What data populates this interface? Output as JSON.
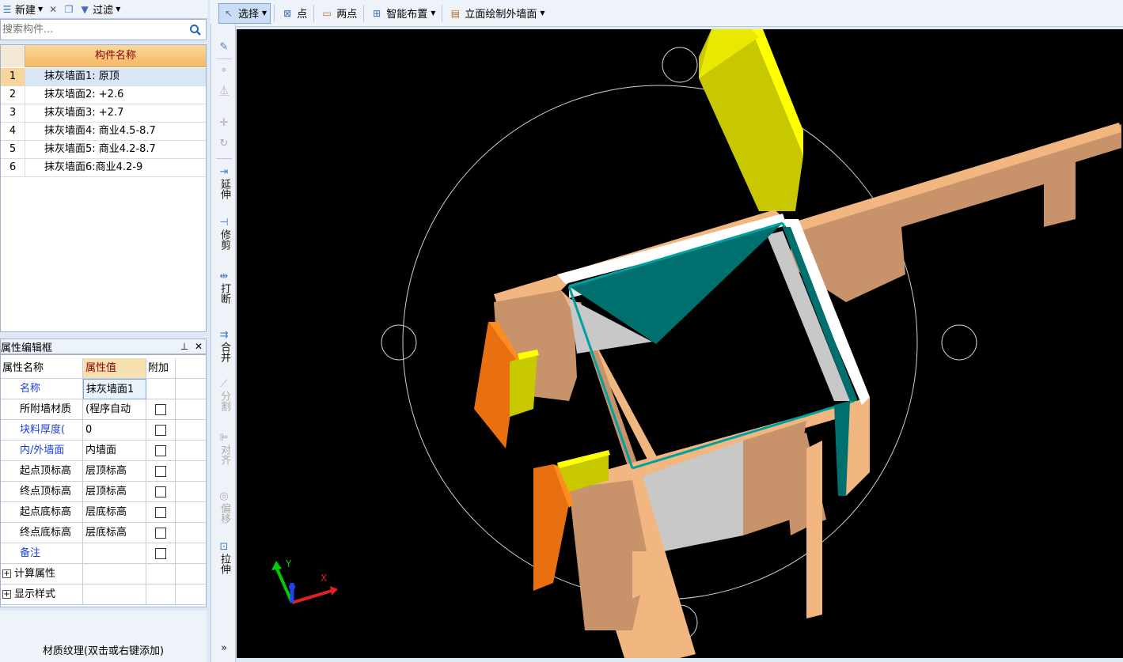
{
  "left_toolbar": {
    "new_label": "新建",
    "filter_label": "过滤"
  },
  "search": {
    "placeholder": "搜索构件..."
  },
  "component_list": {
    "header": "构件名称",
    "rows": [
      {
        "index": "1",
        "name": "抹灰墙面1: 原顶"
      },
      {
        "index": "2",
        "name": "抹灰墙面2: +2.6"
      },
      {
        "index": "3",
        "name": "抹灰墙面3: +2.7"
      },
      {
        "index": "4",
        "name": "抹灰墙面4: 商业4.5-8.7"
      },
      {
        "index": "5",
        "name": "抹灰墙面5: 商业4.2-8.7"
      },
      {
        "index": "6",
        "name": "抹灰墙面6:商业4.2-9"
      }
    ]
  },
  "property_panel": {
    "title": "属性编辑框",
    "pin_icon": "pin-icon",
    "close_icon": "close-icon",
    "headers": {
      "name": "属性名称",
      "value": "属性值",
      "extra": "附加"
    },
    "rows": [
      {
        "name": "名称",
        "value": "抹灰墙面1",
        "blue": true,
        "checkbox": false
      },
      {
        "name": "所附墙材质",
        "value": "(程序自动",
        "blue": false,
        "checkbox": true
      },
      {
        "name": "块料厚度(",
        "value": "0",
        "blue": true,
        "checkbox": true
      },
      {
        "name": "内/外墙面",
        "value": "内墙面",
        "blue": true,
        "checkbox": true
      },
      {
        "name": "起点顶标高",
        "value": "层顶标高",
        "blue": false,
        "checkbox": true
      },
      {
        "name": "终点顶标高",
        "value": "层顶标高",
        "blue": false,
        "checkbox": true
      },
      {
        "name": "起点底标高",
        "value": "层底标高",
        "blue": false,
        "checkbox": true
      },
      {
        "name": "终点底标高",
        "value": "层底标高",
        "blue": false,
        "checkbox": true
      },
      {
        "name": "备注",
        "value": "",
        "blue": true,
        "checkbox": true
      }
    ],
    "groups": [
      "计算属性",
      "显示样式"
    ],
    "texture_label": "材质纹理(双击或右键添加)"
  },
  "main_toolbar": {
    "select_label": "选择",
    "point_label": "点",
    "two_point_label": "两点",
    "smart_layout_label": "智能布置",
    "elevation_label": "立面绘制外墙面"
  },
  "side_tools": {
    "extend": "延伸",
    "trim": "修剪",
    "break": "打断",
    "merge": "合并",
    "split": "分割",
    "align": "对齐",
    "offset": "偏移",
    "stretch": "拉伸"
  },
  "viewport": {
    "axis_x": "X",
    "axis_y": "Y",
    "background": "#000000",
    "wall_color": "#f2b680",
    "teal_color": "#00706e",
    "yellow_color": "#c8c800",
    "orange_color": "#e87010"
  }
}
